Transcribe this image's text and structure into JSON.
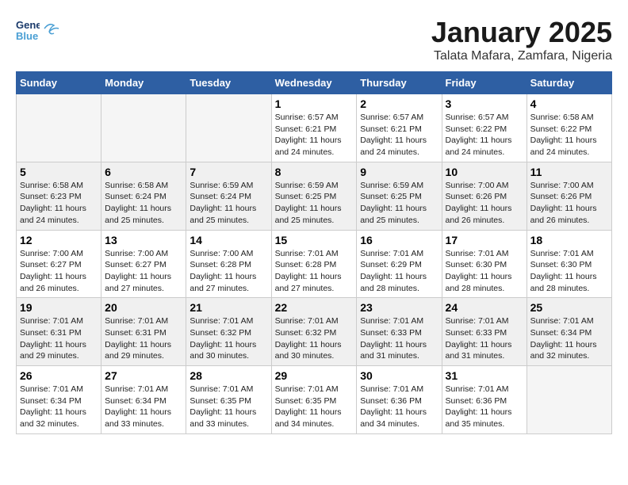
{
  "logo": {
    "line1": "General",
    "line2": "Blue"
  },
  "header": {
    "month": "January 2025",
    "location": "Talata Mafara, Zamfara, Nigeria"
  },
  "weekdays": [
    "Sunday",
    "Monday",
    "Tuesday",
    "Wednesday",
    "Thursday",
    "Friday",
    "Saturday"
  ],
  "weeks": [
    [
      {
        "day": "",
        "info": ""
      },
      {
        "day": "",
        "info": ""
      },
      {
        "day": "",
        "info": ""
      },
      {
        "day": "1",
        "info": "Sunrise: 6:57 AM\nSunset: 6:21 PM\nDaylight: 11 hours\nand 24 minutes."
      },
      {
        "day": "2",
        "info": "Sunrise: 6:57 AM\nSunset: 6:21 PM\nDaylight: 11 hours\nand 24 minutes."
      },
      {
        "day": "3",
        "info": "Sunrise: 6:57 AM\nSunset: 6:22 PM\nDaylight: 11 hours\nand 24 minutes."
      },
      {
        "day": "4",
        "info": "Sunrise: 6:58 AM\nSunset: 6:22 PM\nDaylight: 11 hours\nand 24 minutes."
      }
    ],
    [
      {
        "day": "5",
        "info": "Sunrise: 6:58 AM\nSunset: 6:23 PM\nDaylight: 11 hours\nand 24 minutes."
      },
      {
        "day": "6",
        "info": "Sunrise: 6:58 AM\nSunset: 6:24 PM\nDaylight: 11 hours\nand 25 minutes."
      },
      {
        "day": "7",
        "info": "Sunrise: 6:59 AM\nSunset: 6:24 PM\nDaylight: 11 hours\nand 25 minutes."
      },
      {
        "day": "8",
        "info": "Sunrise: 6:59 AM\nSunset: 6:25 PM\nDaylight: 11 hours\nand 25 minutes."
      },
      {
        "day": "9",
        "info": "Sunrise: 6:59 AM\nSunset: 6:25 PM\nDaylight: 11 hours\nand 25 minutes."
      },
      {
        "day": "10",
        "info": "Sunrise: 7:00 AM\nSunset: 6:26 PM\nDaylight: 11 hours\nand 26 minutes."
      },
      {
        "day": "11",
        "info": "Sunrise: 7:00 AM\nSunset: 6:26 PM\nDaylight: 11 hours\nand 26 minutes."
      }
    ],
    [
      {
        "day": "12",
        "info": "Sunrise: 7:00 AM\nSunset: 6:27 PM\nDaylight: 11 hours\nand 26 minutes."
      },
      {
        "day": "13",
        "info": "Sunrise: 7:00 AM\nSunset: 6:27 PM\nDaylight: 11 hours\nand 27 minutes."
      },
      {
        "day": "14",
        "info": "Sunrise: 7:00 AM\nSunset: 6:28 PM\nDaylight: 11 hours\nand 27 minutes."
      },
      {
        "day": "15",
        "info": "Sunrise: 7:01 AM\nSunset: 6:28 PM\nDaylight: 11 hours\nand 27 minutes."
      },
      {
        "day": "16",
        "info": "Sunrise: 7:01 AM\nSunset: 6:29 PM\nDaylight: 11 hours\nand 28 minutes."
      },
      {
        "day": "17",
        "info": "Sunrise: 7:01 AM\nSunset: 6:30 PM\nDaylight: 11 hours\nand 28 minutes."
      },
      {
        "day": "18",
        "info": "Sunrise: 7:01 AM\nSunset: 6:30 PM\nDaylight: 11 hours\nand 28 minutes."
      }
    ],
    [
      {
        "day": "19",
        "info": "Sunrise: 7:01 AM\nSunset: 6:31 PM\nDaylight: 11 hours\nand 29 minutes."
      },
      {
        "day": "20",
        "info": "Sunrise: 7:01 AM\nSunset: 6:31 PM\nDaylight: 11 hours\nand 29 minutes."
      },
      {
        "day": "21",
        "info": "Sunrise: 7:01 AM\nSunset: 6:32 PM\nDaylight: 11 hours\nand 30 minutes."
      },
      {
        "day": "22",
        "info": "Sunrise: 7:01 AM\nSunset: 6:32 PM\nDaylight: 11 hours\nand 30 minutes."
      },
      {
        "day": "23",
        "info": "Sunrise: 7:01 AM\nSunset: 6:33 PM\nDaylight: 11 hours\nand 31 minutes."
      },
      {
        "day": "24",
        "info": "Sunrise: 7:01 AM\nSunset: 6:33 PM\nDaylight: 11 hours\nand 31 minutes."
      },
      {
        "day": "25",
        "info": "Sunrise: 7:01 AM\nSunset: 6:34 PM\nDaylight: 11 hours\nand 32 minutes."
      }
    ],
    [
      {
        "day": "26",
        "info": "Sunrise: 7:01 AM\nSunset: 6:34 PM\nDaylight: 11 hours\nand 32 minutes."
      },
      {
        "day": "27",
        "info": "Sunrise: 7:01 AM\nSunset: 6:34 PM\nDaylight: 11 hours\nand 33 minutes."
      },
      {
        "day": "28",
        "info": "Sunrise: 7:01 AM\nSunset: 6:35 PM\nDaylight: 11 hours\nand 33 minutes."
      },
      {
        "day": "29",
        "info": "Sunrise: 7:01 AM\nSunset: 6:35 PM\nDaylight: 11 hours\nand 34 minutes."
      },
      {
        "day": "30",
        "info": "Sunrise: 7:01 AM\nSunset: 6:36 PM\nDaylight: 11 hours\nand 34 minutes."
      },
      {
        "day": "31",
        "info": "Sunrise: 7:01 AM\nSunset: 6:36 PM\nDaylight: 11 hours\nand 35 minutes."
      },
      {
        "day": "",
        "info": ""
      }
    ]
  ]
}
